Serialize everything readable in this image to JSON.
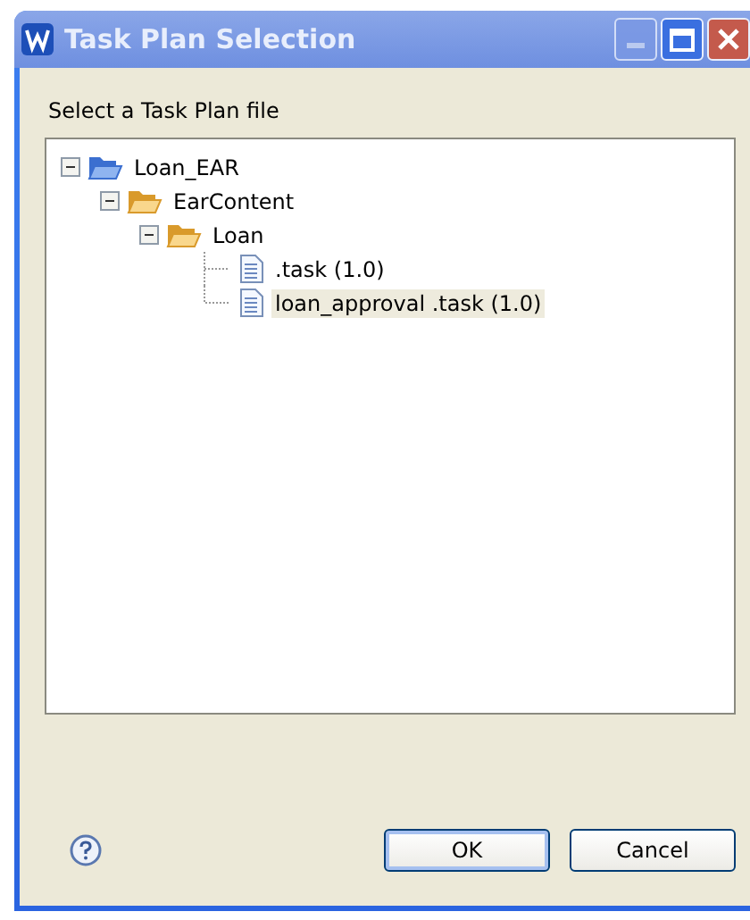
{
  "window": {
    "title": "Task Plan Selection"
  },
  "prompt": "Select a Task Plan file",
  "tree": [
    {
      "label": "Loan_EAR",
      "kind": "project",
      "expanded": true,
      "selected": false,
      "children": [
        {
          "label": "EarContent",
          "kind": "folder",
          "expanded": true,
          "selected": false,
          "children": [
            {
              "label": "Loan",
              "kind": "folder",
              "expanded": true,
              "selected": false,
              "children": [
                {
                  "label": ".task (1.0)",
                  "kind": "file",
                  "selected": false
                },
                {
                  "label": "loan_approval .task (1.0)",
                  "kind": "file",
                  "selected": true
                }
              ]
            }
          ]
        }
      ]
    }
  ],
  "buttons": [
    "OK",
    "Cancel"
  ]
}
